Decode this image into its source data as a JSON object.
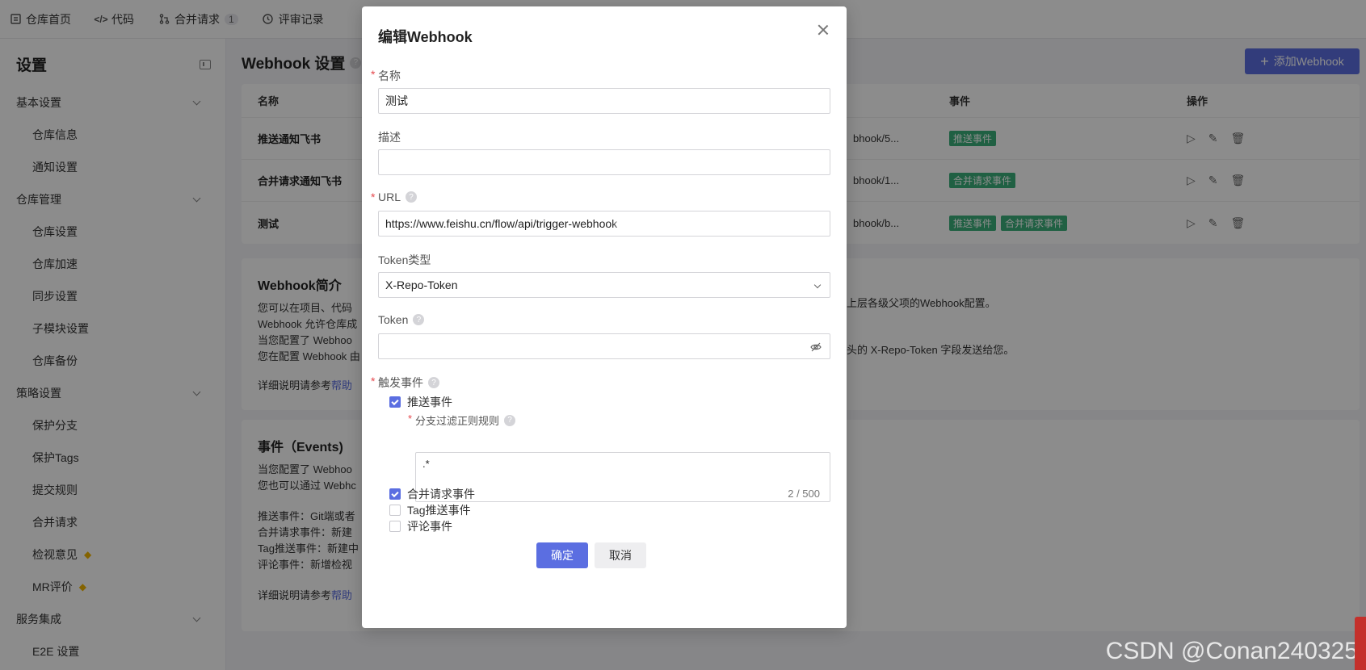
{
  "topnav": {
    "items": [
      {
        "label": "仓库首页",
        "icon": "repo-home-icon"
      },
      {
        "label": "代码",
        "icon": "code-icon"
      },
      {
        "label": "合并请求",
        "icon": "merge-request-icon",
        "badge": "1"
      },
      {
        "label": "评审记录",
        "icon": "review-icon"
      }
    ]
  },
  "sidebar": {
    "title": "设置",
    "groups": [
      {
        "label": "基本设置",
        "items": [
          "仓库信息",
          "通知设置"
        ]
      },
      {
        "label": "仓库管理",
        "items": [
          "仓库设置",
          "仓库加速",
          "同步设置",
          "子模块设置",
          "仓库备份"
        ]
      },
      {
        "label": "策略设置",
        "items": [
          "保护分支",
          "保护Tags",
          "提交规则",
          "合并请求",
          "检视意见",
          "MR评价"
        ]
      },
      {
        "label": "服务集成",
        "items": [
          "E2E 设置"
        ]
      }
    ]
  },
  "main": {
    "title": "Webhook 设置",
    "add_button": "添加Webhook",
    "table": {
      "headers": {
        "name": "名称",
        "events": "事件",
        "actions": "操作"
      },
      "rows": [
        {
          "name": "推送通知飞书",
          "url": "bhook/5...",
          "events": [
            "推送事件"
          ]
        },
        {
          "name": "合并请求通知飞书",
          "url": "bhook/1...",
          "events": [
            "合并请求事件"
          ]
        },
        {
          "name": "测试",
          "url": "bhook/b...",
          "events": [
            "推送事件",
            "合并请求事件"
          ]
        }
      ]
    },
    "intro": {
      "title": "Webhook简介",
      "lines": [
        "您可以在项目、代码",
        "Webhook 允许仓库成",
        "当您配置了 Webhoo",
        "您在配置 Webhook 由"
      ],
      "right_lines": [
        "自动继承上层各级父项的Webhook配置。",
        "放在请求头的 X-Repo-Token 字段发送给您。"
      ],
      "ref_text": "详细说明请参考",
      "ref_link": "帮助"
    },
    "events": {
      "title": "事件（Events)",
      "lines": [
        "当您配置了 Webhoo",
        "您也可以通过 Webhc"
      ],
      "types": [
        "推送事件：Git端或者",
        "合并请求事件：新建",
        "Tag推送事件：新建中",
        "评论事件：新增检视"
      ],
      "ref_text": "详细说明请参考",
      "ref_link": "帮助"
    }
  },
  "modal": {
    "title": "编辑Webhook",
    "name_label": "名称",
    "name_value": "测试",
    "desc_label": "描述",
    "desc_value": "",
    "url_label": "URL",
    "url_value": "https://www.feishu.cn/flow/api/trigger-webhook",
    "token_type_label": "Token类型",
    "token_type_value": "X-Repo-Token",
    "token_label": "Token",
    "token_value": "",
    "events_label": "触发事件",
    "push_event": {
      "label": "推送事件",
      "checked": true
    },
    "branch_filter_label": "分支过滤正则规则",
    "branch_filter_value": ".*",
    "branch_filter_counter": "2 / 500",
    "mr_event": {
      "label": "合并请求事件",
      "checked": true
    },
    "tag_event": {
      "label": "Tag推送事件",
      "checked": false
    },
    "comment_event": {
      "label": "评论事件",
      "checked": false
    },
    "ok_button": "确定",
    "cancel_button": "取消"
  },
  "watermark": "CSDN @Conan240325",
  "colors": {
    "accent": "#5b6ee1",
    "tag": "#3bb07a",
    "required": "#e5484d"
  }
}
